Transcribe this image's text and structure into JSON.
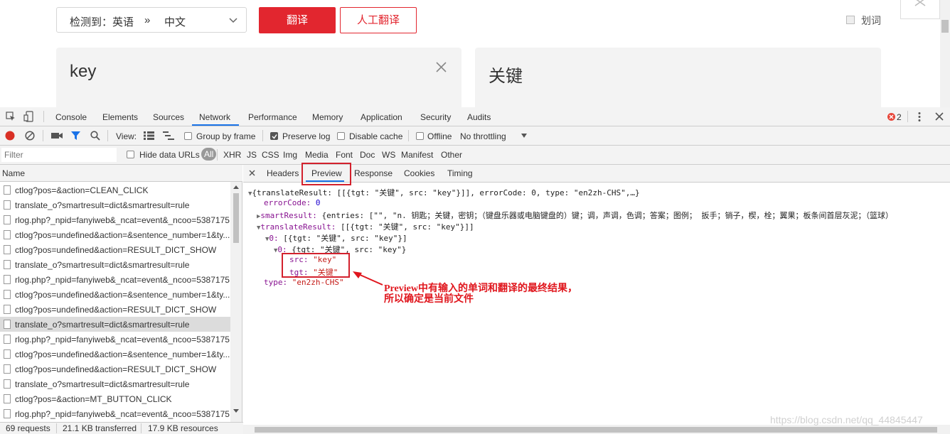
{
  "page": {
    "detect_label": "检测到：英语",
    "arrow": "»",
    "target_lang": "中文",
    "translate_button": "翻译",
    "human_translate_button": "人工翻译",
    "word_select_label": "划词",
    "source_text": "key",
    "target_text": "关键"
  },
  "devtools": {
    "panel_tabs": [
      "Console",
      "Elements",
      "Sources",
      "Network",
      "Performance",
      "Memory",
      "Application",
      "Security",
      "Audits"
    ],
    "active_panel": "Network",
    "error_count": "2",
    "toolbar": {
      "view_label": "View:",
      "group_by_frame": "Group by frame",
      "preserve_log": "Preserve log",
      "disable_cache": "Disable cache",
      "offline": "Offline",
      "throttling": "No throttling"
    },
    "filter": {
      "placeholder": "Filter",
      "hide_data_urls": "Hide data URLs",
      "types": [
        "All",
        "XHR",
        "JS",
        "CSS",
        "Img",
        "Media",
        "Font",
        "Doc",
        "WS",
        "Manifest",
        "Other"
      ]
    },
    "name_header": "Name",
    "requests": [
      "ctlog?pos=&action=CLEAN_CLICK",
      "translate_o?smartresult=dict&smartresult=rule",
      "rlog.php?_npid=fanyiweb&_ncat=event&_ncoo=5387175",
      "ctlog?pos=undefined&action=&sentence_number=1&ty...",
      "ctlog?pos=undefined&action=RESULT_DICT_SHOW",
      "translate_o?smartresult=dict&smartresult=rule",
      "rlog.php?_npid=fanyiweb&_ncat=event&_ncoo=5387175",
      "ctlog?pos=undefined&action=&sentence_number=1&ty...",
      "ctlog?pos=undefined&action=RESULT_DICT_SHOW",
      "translate_o?smartresult=dict&smartresult=rule",
      "rlog.php?_npid=fanyiweb&_ncat=event&_ncoo=5387175",
      "ctlog?pos=undefined&action=&sentence_number=1&ty...",
      "ctlog?pos=undefined&action=RESULT_DICT_SHOW",
      "translate_o?smartresult=dict&smartresult=rule",
      "ctlog?pos=&action=MT_BUTTON_CLICK",
      "rlog.php?_npid=fanyiweb&_ncat=event&_ncoo=5387175"
    ],
    "selected_request_index": 9,
    "detail_tabs": [
      "Headers",
      "Preview",
      "Response",
      "Cookies",
      "Timing"
    ],
    "active_detail_tab": "Preview",
    "preview": {
      "root": "{translateResult: [[{tgt: \"关键\", src: \"key\"}]], errorCode: 0, type: \"en2zh-CHS\",…}",
      "errorCode_key": "errorCode:",
      "errorCode_val": "0",
      "smart_key": "smartResult:",
      "smart_val": "{entries: [\"\", \"n. 钥匙；关键，密钥；（键盘乐器或电脑键盘的）键；调，声调，色调；答案；图例；  扳手；销子，楔，栓；翼果；板条间首层灰泥；（篮球）",
      "tr_key": "translateResult:",
      "tr_val": "[[{tgt: \"关键\", src: \"key\"}]]",
      "l0_key": "0:",
      "l0_val": "[{tgt: \"关键\", src: \"key\"}]",
      "l00_key": "0:",
      "l00_val": "{tgt: \"关键\", src: \"key\"}",
      "src_key": "src:",
      "src_val": "\"key\"",
      "tgt_key": "tgt:",
      "tgt_val": "\"关键\"",
      "type_key": "type:",
      "type_val": "\"en2zh-CHS\""
    },
    "annotation": {
      "line1": "Preview中有输入的单词和翻译的最终结果，",
      "line2": "所以确定是当前文件"
    },
    "status": {
      "requests": "69 requests",
      "transferred": "21.1 KB transferred",
      "resources": "17.9 KB resources"
    },
    "watermark": "https://blog.csdn.net/qq_44845447"
  },
  "colors": {
    "brand_red": "#e2262f",
    "annotation_red": "#d3212d",
    "devtools_blue": "#1a73e8"
  }
}
